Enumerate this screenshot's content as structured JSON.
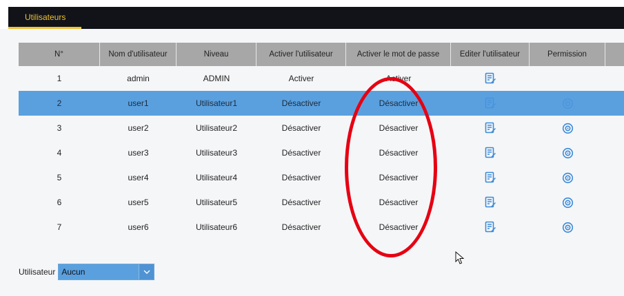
{
  "tabs": [
    {
      "label": "Utilisateurs"
    }
  ],
  "table": {
    "columns": [
      "N°",
      "Nom d'utilisateur",
      "Niveau",
      "Activer l'utilisateur",
      "Activer le mot de passe",
      "Editer l'utilisateur",
      "Permission"
    ],
    "rows": [
      {
        "no": "1",
        "username": "admin",
        "level": "ADMIN",
        "enable_user": "Activer",
        "enable_password": "Activer",
        "edit_icon": "edit-icon",
        "permission_icon": "",
        "selected": false
      },
      {
        "no": "2",
        "username": "user1",
        "level": "Utilisateur1",
        "enable_user": "Désactiver",
        "enable_password": "Désactiver",
        "edit_icon": "edit-icon",
        "permission_icon": "gear-icon",
        "selected": true
      },
      {
        "no": "3",
        "username": "user2",
        "level": "Utilisateur2",
        "enable_user": "Désactiver",
        "enable_password": "Désactiver",
        "edit_icon": "edit-icon",
        "permission_icon": "gear-icon",
        "selected": false
      },
      {
        "no": "4",
        "username": "user3",
        "level": "Utilisateur3",
        "enable_user": "Désactiver",
        "enable_password": "Désactiver",
        "edit_icon": "edit-icon",
        "permission_icon": "gear-icon",
        "selected": false
      },
      {
        "no": "5",
        "username": "user4",
        "level": "Utilisateur4",
        "enable_user": "Désactiver",
        "enable_password": "Désactiver",
        "edit_icon": "edit-icon",
        "permission_icon": "gear-icon",
        "selected": false
      },
      {
        "no": "6",
        "username": "user5",
        "level": "Utilisateur5",
        "enable_user": "Désactiver",
        "enable_password": "Désactiver",
        "edit_icon": "edit-icon",
        "permission_icon": "gear-icon",
        "selected": false
      },
      {
        "no": "7",
        "username": "user6",
        "level": "Utilisateur6",
        "enable_user": "Désactiver",
        "enable_password": "Désactiver",
        "edit_icon": "edit-icon",
        "permission_icon": "gear-icon",
        "selected": false
      }
    ]
  },
  "filter": {
    "label": "Utilisateur",
    "selected": "Aucun"
  },
  "colors": {
    "tab_accent": "#f1c232",
    "header_bg": "#a7a7a7",
    "selection": "#5aa0df",
    "icon_blue": "#3b8ad9",
    "annotation": "#e60012"
  },
  "annotation": {
    "shape": "ellipse",
    "target": "enable_password column"
  }
}
